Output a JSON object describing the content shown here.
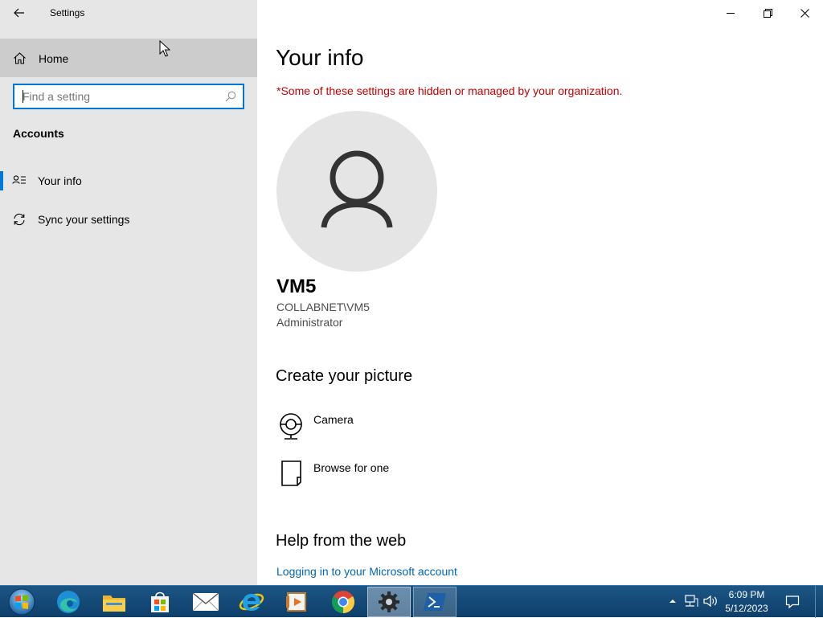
{
  "window": {
    "app_title": "Settings"
  },
  "sidebar": {
    "home_label": "Home",
    "search_placeholder": "Find a setting",
    "section_label": "Accounts",
    "items": [
      {
        "label": "Your info",
        "icon": "person-list-icon",
        "selected": true
      },
      {
        "label": "Sync your settings",
        "icon": "sync-icon",
        "selected": false
      }
    ]
  },
  "main": {
    "title": "Your info",
    "warning": "*Some of these settings are hidden or managed by your organization.",
    "user": {
      "name": "VM5",
      "account": "COLLABNET\\VM5",
      "role": "Administrator"
    },
    "create_picture": {
      "heading": "Create your picture",
      "options": [
        {
          "label": "Camera",
          "icon": "camera-icon"
        },
        {
          "label": "Browse for one",
          "icon": "browse-icon"
        }
      ]
    },
    "help": {
      "heading": "Help from the web",
      "link": "Logging in to your Microsoft account"
    }
  },
  "taskbar": {
    "apps": [
      "start",
      "edge",
      "file-explorer",
      "store",
      "mail",
      "internet-explorer",
      "media-player",
      "chrome",
      "settings",
      "powershell"
    ],
    "clock_time": "6:09 PM",
    "clock_date": "5/12/2023"
  },
  "colors": {
    "accent": "#0078d7",
    "warning": "#c50000",
    "link": "#0067b8",
    "sidebar_bg": "#e6e6e6"
  }
}
